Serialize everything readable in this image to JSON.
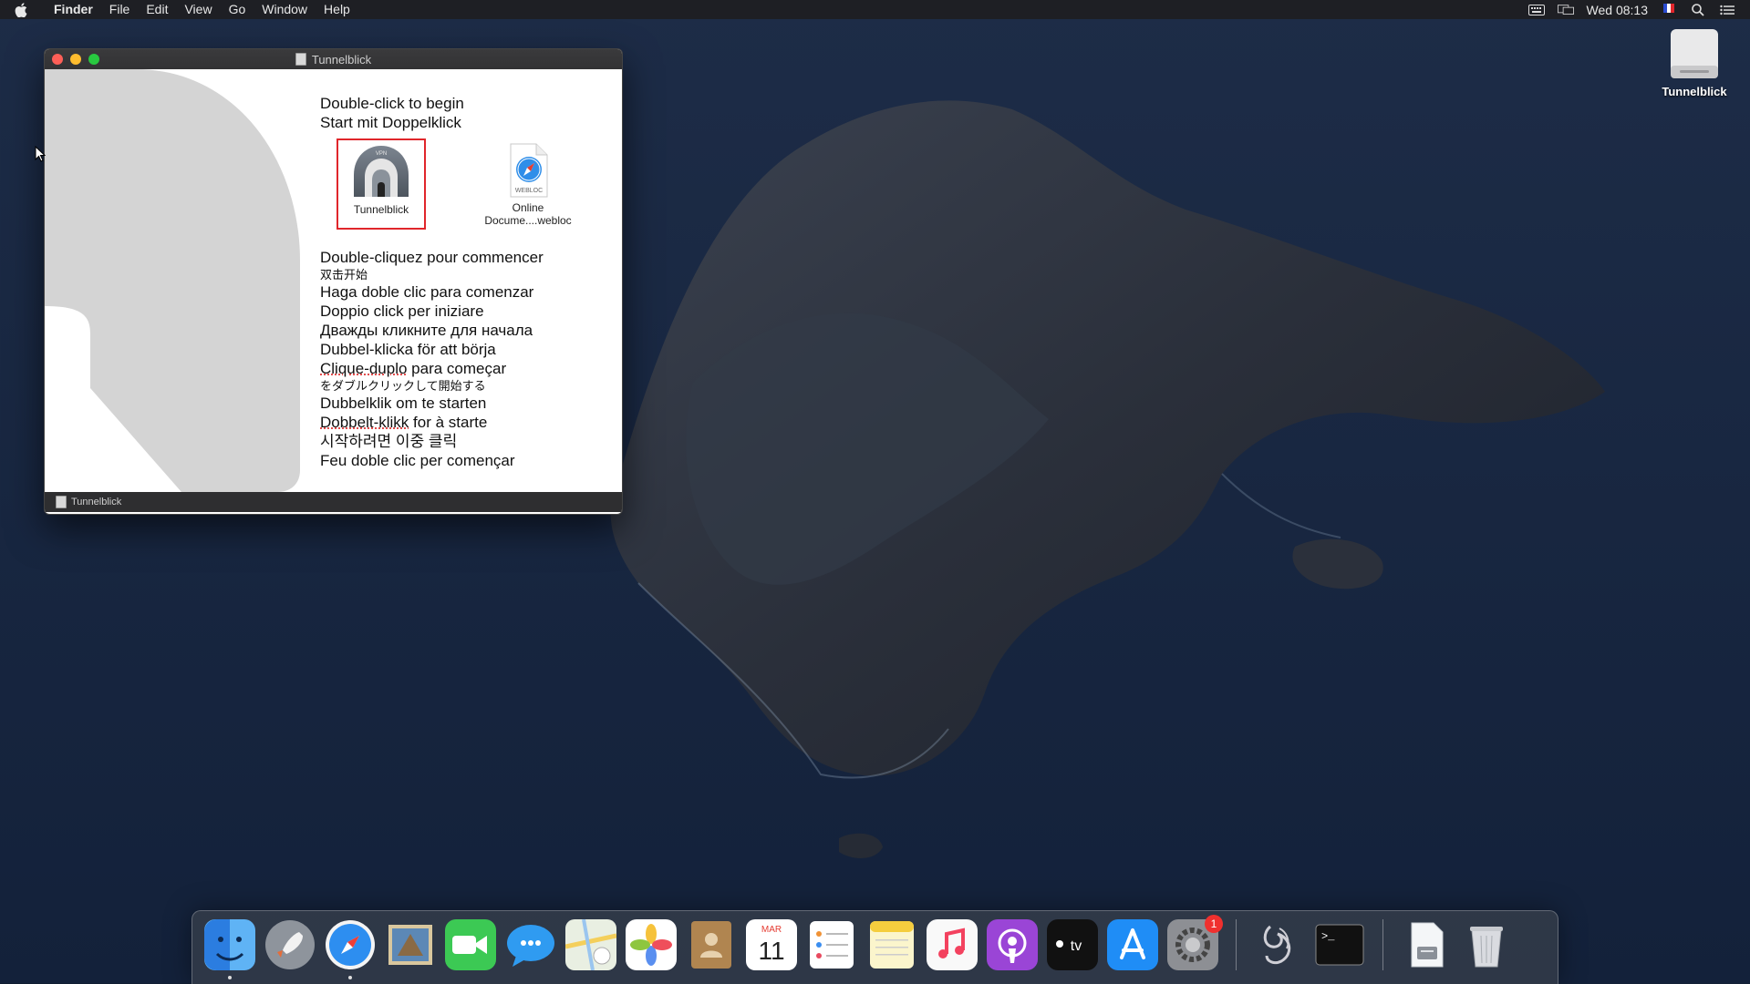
{
  "menubar": {
    "app_name": "Finder",
    "items": [
      "File",
      "Edit",
      "View",
      "Go",
      "Window",
      "Help"
    ],
    "clock": "Wed 08:13",
    "status_icons": [
      "keyboard-icon",
      "display-mirror-icon",
      "flag-fr-icon",
      "spotlight-search-icon",
      "notification-center-icon"
    ]
  },
  "window": {
    "title": "Tunnelblick",
    "status_label": "Tunnelblick",
    "intro_lines": [
      "Double-click to begin",
      "Start mit Doppelklick"
    ],
    "files": [
      {
        "label": "Tunnelblick",
        "icon": "tunnelblick-app-icon",
        "selected": true
      },
      {
        "label_line1": "Online",
        "label_line2": "Docume....webloc",
        "icon": "webloc-icon",
        "badge": "WEBLOC"
      }
    ],
    "tunnel_badge": "VPN",
    "languages": [
      "Double-cliquez pour commencer",
      "双击开始",
      "Haga doble clic para comenzar",
      "Doppio click per iniziare",
      "Дважды кликните для начала",
      "Dubbel-klicka för att börja",
      "Clique-duplo para começar",
      "をダブルクリックして開始する",
      "Dubbelklik om te starten",
      "Dobbelt-klikk for à starte",
      "시작하려면 이중 클릭",
      "Feu doble clic per començar"
    ],
    "lang_pt_underlined": "Clique-duplo",
    "lang_pt_rest": " para começar",
    "lang_no_underlined": "Dobbelt-klikk",
    "lang_no_rest": " for à starte"
  },
  "desktop": {
    "drive_label": "Tunnelblick"
  },
  "dock": {
    "apps": [
      {
        "name": "Finder",
        "icon": "finder-icon",
        "running": true
      },
      {
        "name": "Launchpad",
        "icon": "launchpad-icon"
      },
      {
        "name": "Safari",
        "icon": "safari-icon",
        "running": true
      },
      {
        "name": "Mail",
        "icon": "mail-icon"
      },
      {
        "name": "FaceTime",
        "icon": "facetime-icon"
      },
      {
        "name": "Messages",
        "icon": "messages-icon"
      },
      {
        "name": "Maps",
        "icon": "maps-icon"
      },
      {
        "name": "Photos",
        "icon": "photos-icon"
      },
      {
        "name": "Contacts",
        "icon": "contacts-icon"
      },
      {
        "name": "Calendar",
        "icon": "calendar-icon",
        "month": "MAR",
        "day": "11"
      },
      {
        "name": "Reminders",
        "icon": "reminders-icon"
      },
      {
        "name": "Notes",
        "icon": "notes-icon"
      },
      {
        "name": "Music",
        "icon": "music-icon"
      },
      {
        "name": "Podcasts",
        "icon": "podcasts-icon"
      },
      {
        "name": "TV",
        "icon": "tv-icon",
        "label": "tv"
      },
      {
        "name": "App Store",
        "icon": "app-store-icon"
      },
      {
        "name": "System Preferences",
        "icon": "system-preferences-icon",
        "badge": "1"
      },
      {
        "name": "Script Editor",
        "icon": "script-icon"
      },
      {
        "name": "Terminal",
        "icon": "terminal-icon",
        "label": ">_"
      },
      {
        "name": "Downloads",
        "icon": "downloads-folder-icon"
      },
      {
        "name": "Trash",
        "icon": "trash-icon"
      }
    ]
  },
  "colors": {
    "selection_border": "#e0262b",
    "menubar_bg": "#1e1e22",
    "desktop_bg": "#17263d"
  }
}
